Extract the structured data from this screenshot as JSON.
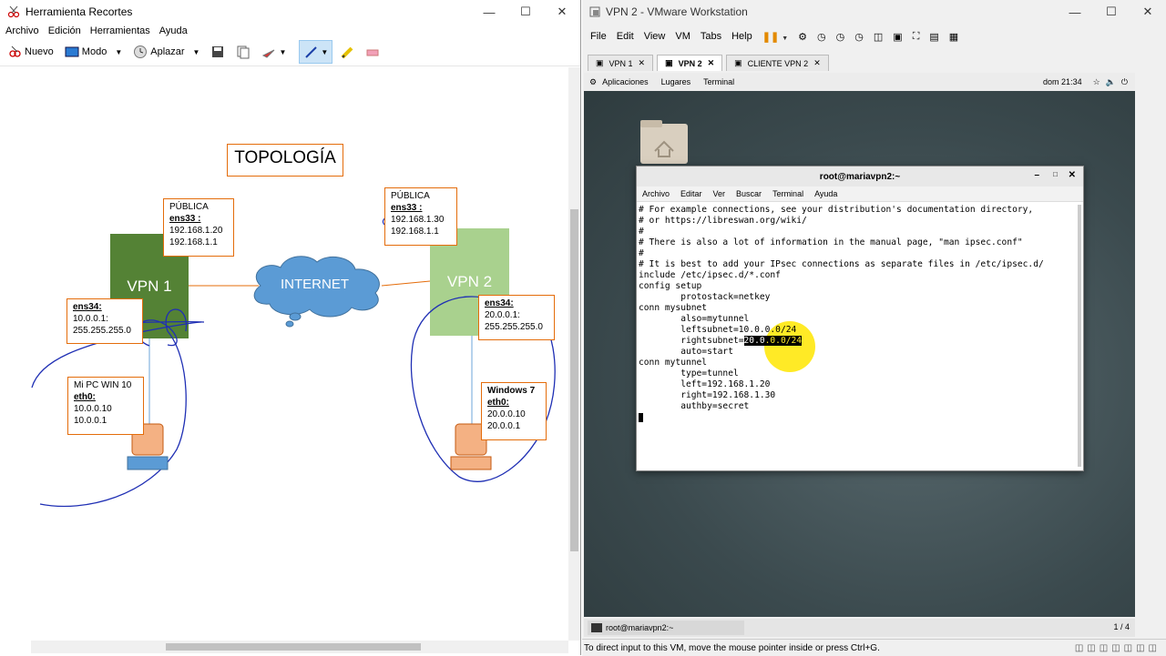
{
  "snip": {
    "title": "Herramienta Recortes",
    "menu": [
      "Archivo",
      "Edición",
      "Herramientas",
      "Ayuda"
    ],
    "toolbar": {
      "new_label": "Nuevo",
      "mode_label": "Modo",
      "delay_label": "Aplazar"
    },
    "diagram": {
      "title": "TOPOLOGÍA",
      "vpn1": "VPN 1",
      "vpn2": "VPN 2",
      "internet": "INTERNET",
      "pub1": {
        "heading": "PÚBLICA",
        "iface": "ens33 :",
        "ip": "192.168.1.20",
        "gw": "192.168.1.1"
      },
      "pub2": {
        "heading": "PÚBLICA",
        "iface": "ens33 :",
        "ip": "192.168.1.30",
        "gw": "192.168.1.1"
      },
      "priv1": {
        "iface": "ens34:",
        "ip": "10.0.0.1:",
        "mask": "255.255.255.0"
      },
      "priv2": {
        "iface": "ens34:",
        "ip": "20.0.0.1:",
        "mask": "255.255.255.0"
      },
      "pc1": {
        "name": "Mi PC WIN 10",
        "iface": "eth0:",
        "ip": "10.0.0.10",
        "gw": "10.0.0.1"
      },
      "pc2": {
        "name": "Windows 7",
        "iface": "eth0:",
        "ip": "20.0.0.10",
        "gw": "20.0.0.1"
      },
      "colors": {
        "vpn1": "#548235",
        "vpn2": "#a9d18e",
        "box_border": "#e46c0a",
        "cloud": "#5b9bd5",
        "pc": "#f4b183",
        "ink": "#1f2fb4"
      }
    }
  },
  "vm": {
    "title": "VPN 2 - VMware Workstation",
    "menu": [
      "File",
      "Edit",
      "View",
      "VM",
      "Tabs",
      "Help"
    ],
    "tabs": [
      "VPN 1",
      "VPN 2",
      "CLIENTE VPN 2"
    ],
    "gnome": {
      "apps": "Aplicaciones",
      "places": "Lugares",
      "terminal": "Terminal",
      "clock": "dom 21:34"
    },
    "terminal": {
      "title": "root@mariavpn2:~",
      "menu": [
        "Archivo",
        "Editar",
        "Ver",
        "Buscar",
        "Terminal",
        "Ayuda"
      ],
      "lines": [
        "# For example connections, see your distribution's documentation directory,",
        "# or https://libreswan.org/wiki/",
        "#",
        "# There is also a lot of information in the manual page, \"man ipsec.conf\"",
        "#",
        "# It is best to add your IPsec connections as separate files in /etc/ipsec.d/",
        "include /etc/ipsec.d/*.conf",
        "",
        "config setup",
        "        protostack=netkey",
        "",
        "conn mysubnet",
        "        also=mytunnel",
        "        leftsubnet=10.0.0.0/24",
        "        rightsubnet=",
        "        auto=start",
        "",
        "conn mytunnel",
        "        type=tunnel",
        "        left=192.168.1.20",
        "        right=192.168.1.30",
        "        authby=secret"
      ],
      "selected_text": "20.0.0.0/24"
    },
    "taskbar": {
      "item": "root@mariavpn2:~",
      "pager": "1 / 4"
    },
    "status": "To direct input to this VM, move the mouse pointer inside or press Ctrl+G."
  }
}
